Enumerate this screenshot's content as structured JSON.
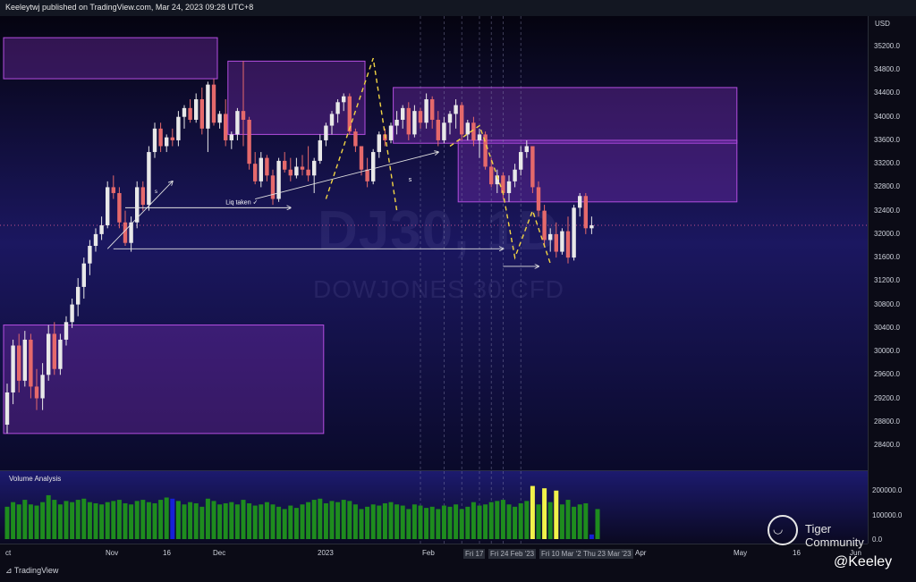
{
  "header": {
    "publish_line": "Keeleytwj published on TradingView.com, Mar 24, 2023 09:28 UTC+8"
  },
  "watermark": {
    "symbol": "DJ30, 1D",
    "description": "DOWJONES 30 CFD"
  },
  "price_axis": {
    "currency": "USD",
    "ticks": [
      "35200.0",
      "34800.0",
      "34400.0",
      "34000.0",
      "33600.0",
      "33200.0",
      "32800.0",
      "32400.0",
      "32000.0",
      "31600.0",
      "31200.0",
      "30800.0",
      "30400.0",
      "30000.0",
      "29600.0",
      "29200.0",
      "28800.0",
      "28400.0"
    ]
  },
  "volume_axis": {
    "ticks": [
      "200000.0",
      "100000.0",
      "0.0"
    ]
  },
  "volume_panel": {
    "title": "Volume Analysis"
  },
  "time_axis": {
    "labels": [
      "ct",
      "Nov",
      "16",
      "Dec",
      "2023",
      "Feb",
      "Apr",
      "May",
      "16",
      "Jun"
    ],
    "date_labels": [
      "Fri 17",
      "Fri 24 Feb '23",
      "Fri 10 Mar '2",
      "Thu 23 Mar '23"
    ]
  },
  "annotations": {
    "liq_taken": "Liq taken ✓",
    "s_mark": "s",
    "s_small": "s"
  },
  "footer": {
    "tradingview": "TradingView",
    "tiger": "Tiger Community",
    "author": "@Keeley"
  },
  "colors": {
    "up": "#e8e8e8",
    "down": "#e5696b",
    "zone": "#8d35c8",
    "yellow": "#f2d544",
    "vol_green": "#1e8c1e",
    "vol_yellow": "#f2f24a",
    "vol_blue": "#1520d8"
  },
  "chart_data": {
    "type": "candlestick",
    "y_unit": "USD",
    "ylim": [
      28000,
      35600
    ],
    "candles": [
      {
        "o": 28750,
        "h": 29450,
        "l": 28600,
        "c": 29300
      },
      {
        "o": 29300,
        "h": 30200,
        "l": 29100,
        "c": 30100
      },
      {
        "o": 30100,
        "h": 30300,
        "l": 29300,
        "c": 29500
      },
      {
        "o": 29500,
        "h": 30350,
        "l": 29400,
        "c": 30200
      },
      {
        "o": 30200,
        "h": 30300,
        "l": 29200,
        "c": 29400
      },
      {
        "o": 29400,
        "h": 29700,
        "l": 29000,
        "c": 29200
      },
      {
        "o": 29200,
        "h": 29800,
        "l": 29000,
        "c": 29600
      },
      {
        "o": 29600,
        "h": 30450,
        "l": 29500,
        "c": 30300
      },
      {
        "o": 30300,
        "h": 30500,
        "l": 29600,
        "c": 29700
      },
      {
        "o": 29700,
        "h": 30300,
        "l": 29600,
        "c": 30200
      },
      {
        "o": 30200,
        "h": 30600,
        "l": 30100,
        "c": 30500
      },
      {
        "o": 30500,
        "h": 30900,
        "l": 30400,
        "c": 30800
      },
      {
        "o": 30800,
        "h": 31250,
        "l": 30600,
        "c": 31100
      },
      {
        "o": 31100,
        "h": 31600,
        "l": 30900,
        "c": 31500
      },
      {
        "o": 31500,
        "h": 31900,
        "l": 31300,
        "c": 31800
      },
      {
        "o": 31800,
        "h": 32100,
        "l": 31700,
        "c": 32000
      },
      {
        "o": 32000,
        "h": 32300,
        "l": 31900,
        "c": 32150
      },
      {
        "o": 32150,
        "h": 32900,
        "l": 32100,
        "c": 32800
      },
      {
        "o": 32800,
        "h": 33000,
        "l": 32600,
        "c": 32700
      },
      {
        "o": 32700,
        "h": 32800,
        "l": 32100,
        "c": 32200
      },
      {
        "o": 32200,
        "h": 32400,
        "l": 31800,
        "c": 31850
      },
      {
        "o": 31850,
        "h": 32300,
        "l": 31700,
        "c": 32200
      },
      {
        "o": 32200,
        "h": 32900,
        "l": 32100,
        "c": 32800
      },
      {
        "o": 32800,
        "h": 32900,
        "l": 32400,
        "c": 32500
      },
      {
        "o": 32500,
        "h": 33500,
        "l": 32400,
        "c": 33400
      },
      {
        "o": 33400,
        "h": 33900,
        "l": 33300,
        "c": 33800
      },
      {
        "o": 33800,
        "h": 33900,
        "l": 33400,
        "c": 33500
      },
      {
        "o": 33500,
        "h": 33700,
        "l": 33400,
        "c": 33650
      },
      {
        "o": 33650,
        "h": 33800,
        "l": 33500,
        "c": 33600
      },
      {
        "o": 33600,
        "h": 34100,
        "l": 33500,
        "c": 34000
      },
      {
        "o": 34000,
        "h": 34200,
        "l": 33800,
        "c": 34150
      },
      {
        "o": 34150,
        "h": 34300,
        "l": 33900,
        "c": 33950
      },
      {
        "o": 33950,
        "h": 34400,
        "l": 33900,
        "c": 34300
      },
      {
        "o": 34300,
        "h": 34500,
        "l": 33700,
        "c": 33800
      },
      {
        "o": 33800,
        "h": 34600,
        "l": 33400,
        "c": 34550
      },
      {
        "o": 34550,
        "h": 34650,
        "l": 33850,
        "c": 33900
      },
      {
        "o": 33900,
        "h": 34100,
        "l": 33800,
        "c": 34050
      },
      {
        "o": 34050,
        "h": 34300,
        "l": 33500,
        "c": 33600
      },
      {
        "o": 33600,
        "h": 33750,
        "l": 33450,
        "c": 33700
      },
      {
        "o": 33700,
        "h": 34150,
        "l": 33600,
        "c": 34100
      },
      {
        "o": 34100,
        "h": 34950,
        "l": 33500,
        "c": 33950
      },
      {
        "o": 33950,
        "h": 34000,
        "l": 33100,
        "c": 33200
      },
      {
        "o": 33200,
        "h": 33400,
        "l": 32850,
        "c": 32900
      },
      {
        "o": 32900,
        "h": 33400,
        "l": 32800,
        "c": 33300
      },
      {
        "o": 33300,
        "h": 33350,
        "l": 32900,
        "c": 33000
      },
      {
        "o": 33000,
        "h": 33100,
        "l": 32500,
        "c": 32600
      },
      {
        "o": 32600,
        "h": 33300,
        "l": 32550,
        "c": 33250
      },
      {
        "o": 33250,
        "h": 33400,
        "l": 33050,
        "c": 33100
      },
      {
        "o": 33100,
        "h": 33300,
        "l": 32900,
        "c": 33000
      },
      {
        "o": 33000,
        "h": 33300,
        "l": 32950,
        "c": 33150
      },
      {
        "o": 33150,
        "h": 33350,
        "l": 33000,
        "c": 33100
      },
      {
        "o": 33100,
        "h": 33500,
        "l": 32900,
        "c": 33000
      },
      {
        "o": 33000,
        "h": 33300,
        "l": 32700,
        "c": 33250
      },
      {
        "o": 33250,
        "h": 33700,
        "l": 33200,
        "c": 33600
      },
      {
        "o": 33600,
        "h": 33900,
        "l": 33500,
        "c": 33850
      },
      {
        "o": 33850,
        "h": 34100,
        "l": 33700,
        "c": 34050
      },
      {
        "o": 34050,
        "h": 34300,
        "l": 33900,
        "c": 34250
      },
      {
        "o": 34250,
        "h": 34400,
        "l": 34100,
        "c": 34350
      },
      {
        "o": 34350,
        "h": 34400,
        "l": 33700,
        "c": 33750
      },
      {
        "o": 33750,
        "h": 33800,
        "l": 33400,
        "c": 33500
      },
      {
        "o": 33500,
        "h": 33500,
        "l": 33000,
        "c": 33100
      },
      {
        "o": 33100,
        "h": 33300,
        "l": 32800,
        "c": 32900
      },
      {
        "o": 32900,
        "h": 33450,
        "l": 32850,
        "c": 33400
      },
      {
        "o": 33400,
        "h": 33750,
        "l": 33300,
        "c": 33700
      },
      {
        "o": 33700,
        "h": 33800,
        "l": 33500,
        "c": 33600
      },
      {
        "o": 33600,
        "h": 33900,
        "l": 33550,
        "c": 33850
      },
      {
        "o": 33850,
        "h": 34100,
        "l": 33700,
        "c": 33950
      },
      {
        "o": 33950,
        "h": 34200,
        "l": 33800,
        "c": 34150
      },
      {
        "o": 34150,
        "h": 34250,
        "l": 33600,
        "c": 33700
      },
      {
        "o": 33700,
        "h": 34200,
        "l": 33650,
        "c": 34100
      },
      {
        "o": 34100,
        "h": 34150,
        "l": 33800,
        "c": 33900
      },
      {
        "o": 33900,
        "h": 34400,
        "l": 33800,
        "c": 34300
      },
      {
        "o": 34300,
        "h": 34350,
        "l": 33800,
        "c": 33950
      },
      {
        "o": 33950,
        "h": 34100,
        "l": 33500,
        "c": 33600
      },
      {
        "o": 33600,
        "h": 34000,
        "l": 33550,
        "c": 33900
      },
      {
        "o": 33900,
        "h": 34100,
        "l": 33700,
        "c": 34050
      },
      {
        "o": 34050,
        "h": 34300,
        "l": 33800,
        "c": 34200
      },
      {
        "o": 34200,
        "h": 34250,
        "l": 33600,
        "c": 33700
      },
      {
        "o": 33700,
        "h": 33950,
        "l": 33600,
        "c": 33900
      },
      {
        "o": 33900,
        "h": 34000,
        "l": 33500,
        "c": 33600
      },
      {
        "o": 33600,
        "h": 33800,
        "l": 33300,
        "c": 33700
      },
      {
        "o": 33700,
        "h": 33750,
        "l": 33100,
        "c": 33150
      },
      {
        "o": 33150,
        "h": 33300,
        "l": 32800,
        "c": 32850
      },
      {
        "o": 32850,
        "h": 33100,
        "l": 32700,
        "c": 33000
      },
      {
        "o": 33000,
        "h": 33050,
        "l": 32600,
        "c": 32700
      },
      {
        "o": 32700,
        "h": 33000,
        "l": 32550,
        "c": 32900
      },
      {
        "o": 32900,
        "h": 33200,
        "l": 32800,
        "c": 33100
      },
      {
        "o": 33100,
        "h": 33500,
        "l": 33000,
        "c": 33400
      },
      {
        "o": 33400,
        "h": 33600,
        "l": 33300,
        "c": 33500
      },
      {
        "o": 33500,
        "h": 33500,
        "l": 32700,
        "c": 32800
      },
      {
        "o": 32800,
        "h": 32900,
        "l": 32300,
        "c": 32400
      },
      {
        "o": 32400,
        "h": 32500,
        "l": 31800,
        "c": 31900
      },
      {
        "o": 31900,
        "h": 32100,
        "l": 31700,
        "c": 32000
      },
      {
        "o": 32000,
        "h": 32200,
        "l": 31600,
        "c": 31700
      },
      {
        "o": 31700,
        "h": 32100,
        "l": 31650,
        "c": 32050
      },
      {
        "o": 32050,
        "h": 32300,
        "l": 31500,
        "c": 31600
      },
      {
        "o": 31600,
        "h": 32500,
        "l": 31550,
        "c": 32450
      },
      {
        "o": 32450,
        "h": 32700,
        "l": 32300,
        "c": 32650
      },
      {
        "o": 32650,
        "h": 32700,
        "l": 32000,
        "c": 32100
      },
      {
        "o": 32100,
        "h": 32300,
        "l": 32000,
        "c": 32150
      }
    ],
    "volume": [
      140,
      160,
      150,
      170,
      150,
      145,
      160,
      190,
      170,
      150,
      165,
      160,
      170,
      175,
      160,
      155,
      150,
      160,
      165,
      170,
      155,
      150,
      165,
      170,
      160,
      155,
      170,
      180,
      175,
      165,
      150,
      160,
      155,
      140,
      175,
      165,
      150,
      155,
      160,
      150,
      170,
      155,
      145,
      150,
      160,
      150,
      140,
      130,
      145,
      135,
      150,
      160,
      170,
      175,
      155,
      165,
      160,
      170,
      165,
      150,
      130,
      140,
      150,
      145,
      155,
      160,
      150,
      145,
      130,
      150,
      145,
      135,
      140,
      130,
      145,
      140,
      150,
      130,
      140,
      160,
      145,
      150,
      160,
      165,
      170,
      150,
      140,
      155,
      165,
      230,
      150,
      220,
      160,
      210,
      150,
      170,
      140,
      150,
      155,
      20,
      130
    ],
    "volume_colors": [
      "g",
      "g",
      "g",
      "g",
      "g",
      "g",
      "g",
      "g",
      "g",
      "g",
      "g",
      "g",
      "g",
      "g",
      "g",
      "g",
      "g",
      "g",
      "g",
      "g",
      "g",
      "g",
      "g",
      "g",
      "g",
      "g",
      "g",
      "g",
      "b",
      "g",
      "g",
      "g",
      "g",
      "g",
      "g",
      "g",
      "g",
      "g",
      "g",
      "g",
      "g",
      "g",
      "g",
      "g",
      "g",
      "g",
      "g",
      "g",
      "g",
      "g",
      "g",
      "g",
      "g",
      "g",
      "g",
      "g",
      "g",
      "g",
      "g",
      "g",
      "g",
      "g",
      "g",
      "g",
      "g",
      "g",
      "g",
      "g",
      "g",
      "g",
      "g",
      "g",
      "g",
      "g",
      "g",
      "g",
      "g",
      "g",
      "g",
      "g",
      "g",
      "g",
      "g",
      "g",
      "g",
      "g",
      "g",
      "g",
      "g",
      "y",
      "g",
      "y",
      "g",
      "y",
      "g",
      "g",
      "g",
      "g",
      "g",
      "b",
      "g"
    ],
    "zones": [
      {
        "from": 0,
        "to": 35,
        "top": 35350,
        "bottom": 34650
      },
      {
        "from": 38,
        "to": 60,
        "top": 34950,
        "bottom": 33700
      },
      {
        "from": 66,
        "to": 123,
        "top": 34500,
        "bottom": 33550
      },
      {
        "from": 77,
        "to": 123,
        "top": 33600,
        "bottom": 32550
      },
      {
        "from": 0,
        "to": 53,
        "top": 30450,
        "bottom": 28600
      }
    ],
    "paths": [
      {
        "type": "arrow",
        "color": "white",
        "points": [
          [
            18,
            31750
          ],
          [
            53,
            31750
          ],
          [
            84,
            31750
          ]
        ]
      },
      {
        "type": "arrow",
        "color": "white",
        "points": [
          [
            17,
            31750
          ],
          [
            28,
            32900
          ]
        ]
      },
      {
        "type": "arrow",
        "color": "white",
        "points": [
          [
            20,
            32450
          ],
          [
            48,
            32450
          ]
        ]
      },
      {
        "type": "arrow",
        "color": "white",
        "points": [
          [
            42,
            32600
          ],
          [
            73,
            33400
          ]
        ]
      },
      {
        "type": "arrow",
        "color": "white",
        "points": [
          [
            84,
            31450
          ],
          [
            90,
            31450
          ]
        ]
      },
      {
        "type": "dashed",
        "color": "yellow",
        "points": [
          [
            54,
            32600
          ],
          [
            62,
            35000
          ],
          [
            66,
            32400
          ]
        ]
      },
      {
        "type": "dashed",
        "color": "yellow",
        "points": [
          [
            75,
            33500
          ],
          [
            80,
            33850
          ],
          [
            84,
            32700
          ],
          [
            86,
            31600
          ],
          [
            89,
            32400
          ],
          [
            92,
            31500
          ]
        ]
      }
    ],
    "vlines": [
      70,
      74,
      77,
      80,
      82,
      84,
      87
    ]
  }
}
